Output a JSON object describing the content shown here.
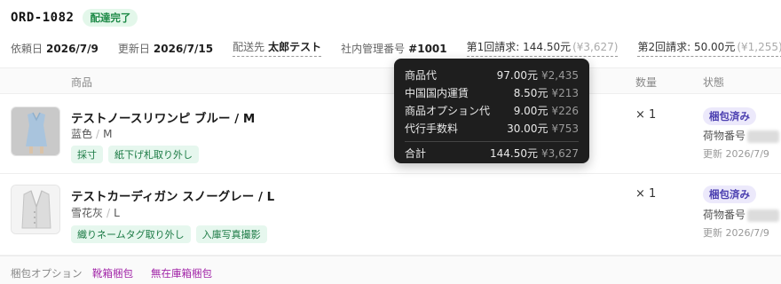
{
  "order": {
    "id": "ORD-1082",
    "status": "配達完了"
  },
  "meta": {
    "created_label": "依頼日",
    "created": "2026/7/9",
    "updated_label": "更新日",
    "updated": "2026/7/15",
    "ship_label": "配送先",
    "ship_to": "太郎テスト",
    "mgmt_label": "社内管理番号",
    "mgmt_no": "#1001",
    "pay1": "第1回請求: 144.50元",
    "pay1_yen": "(¥3,627)",
    "pay2": "第2回請求: 50.00元",
    "pay2_yen": "(¥1,255)"
  },
  "table": {
    "col_product": "商品",
    "col_qty": "数量",
    "col_status": "状態"
  },
  "items": [
    {
      "name": "テストノースリワンピ ブルー / M",
      "color": "蓝色",
      "size": "M",
      "tags": [
        "採寸",
        "紙下げ札取り外し"
      ],
      "qty": "× 1",
      "status": "梱包済み",
      "track_label": "荷物番号",
      "updated": "更新 2026/7/9"
    },
    {
      "name": "テストカーディガン スノーグレー / L",
      "color": "雪花灰",
      "size": "L",
      "tags": [
        "織りネームタグ取り外し",
        "入庫写真撮影"
      ],
      "qty": "× 1",
      "status": "梱包済み",
      "track_label": "荷物番号",
      "updated": "更新 2026/7/9"
    }
  ],
  "footer": {
    "label": "梱包オプション",
    "options": [
      "靴箱梱包",
      "無在庫箱梱包"
    ]
  },
  "popup": {
    "rows": [
      {
        "k": "商品代",
        "v": "97.00元",
        "y": "¥2,435"
      },
      {
        "k": "中国国内運賃",
        "v": "8.50元",
        "y": "¥213"
      },
      {
        "k": "商品オプション代",
        "v": "9.00元",
        "y": "¥226"
      },
      {
        "k": "代行手数料",
        "v": "30.00元",
        "y": "¥753"
      }
    ],
    "total": {
      "k": "合計",
      "v": "144.50元",
      "y": "¥3,627"
    }
  },
  "colors": {
    "done_badge": "#1e8a47",
    "status_badge": "#4b3fb0",
    "tag": "#1b7a44",
    "option": "#a226a8"
  }
}
